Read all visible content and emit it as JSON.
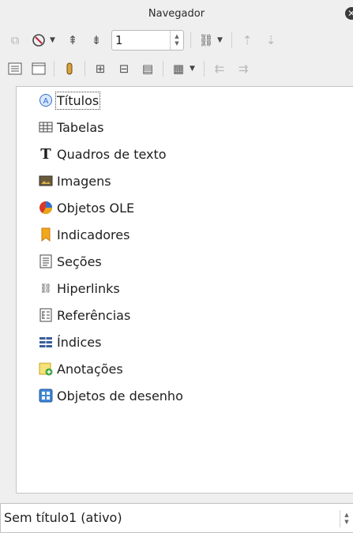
{
  "window": {
    "title": "Navegador"
  },
  "toolbar1": {
    "page_value": "1"
  },
  "tree": {
    "items": [
      {
        "label": "Títulos",
        "icon": "headings-icon"
      },
      {
        "label": "Tabelas",
        "icon": "table-icon"
      },
      {
        "label": "Quadros de texto",
        "icon": "text-frame-icon"
      },
      {
        "label": "Imagens",
        "icon": "image-icon"
      },
      {
        "label": "Objetos OLE",
        "icon": "ole-object-icon"
      },
      {
        "label": "Indicadores",
        "icon": "bookmark-icon"
      },
      {
        "label": "Seções",
        "icon": "section-icon"
      },
      {
        "label": "Hiperlinks",
        "icon": "hyperlink-icon"
      },
      {
        "label": "Referências",
        "icon": "reference-icon"
      },
      {
        "label": "Índices",
        "icon": "index-icon"
      },
      {
        "label": "Anotações",
        "icon": "comment-icon"
      },
      {
        "label": "Objetos de desenho",
        "icon": "drawing-object-icon"
      }
    ]
  },
  "document_select": {
    "value": "Sem título1 (ativo)"
  },
  "colors": {
    "selected_icon_blue": "#2e6fd1",
    "background": "#efefef"
  }
}
